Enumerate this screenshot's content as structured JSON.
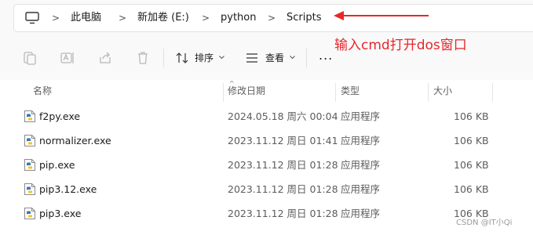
{
  "breadcrumb": {
    "items": [
      "此电脑",
      "新加卷 (E:)",
      "python",
      "Scripts"
    ],
    "separator": ">"
  },
  "annotation": {
    "text": "输入cmd打开dos窗口",
    "color": "#e8262a"
  },
  "toolbar": {
    "icons": [
      "copy-icon",
      "rename-icon",
      "share-icon",
      "delete-icon"
    ],
    "sort_label": "排序",
    "view_label": "查看",
    "more_label": "..."
  },
  "columns": {
    "name": "名称",
    "modified": "修改日期",
    "type": "类型",
    "size": "大小"
  },
  "files": [
    {
      "name": "f2py.exe",
      "modified": "2024.05.18 周六 00:04",
      "type": "应用程序",
      "size": "106 KB"
    },
    {
      "name": "normalizer.exe",
      "modified": "2023.11.12 周日 01:41",
      "type": "应用程序",
      "size": "106 KB"
    },
    {
      "name": "pip.exe",
      "modified": "2023.11.12 周日 01:28",
      "type": "应用程序",
      "size": "106 KB"
    },
    {
      "name": "pip3.12.exe",
      "modified": "2023.11.12 周日 01:28",
      "type": "应用程序",
      "size": "106 KB"
    },
    {
      "name": "pip3.exe",
      "modified": "2023.11.12 周日 01:28",
      "type": "应用程序",
      "size": "106 KB"
    }
  ],
  "watermark": "CSDN @IT小Qi"
}
